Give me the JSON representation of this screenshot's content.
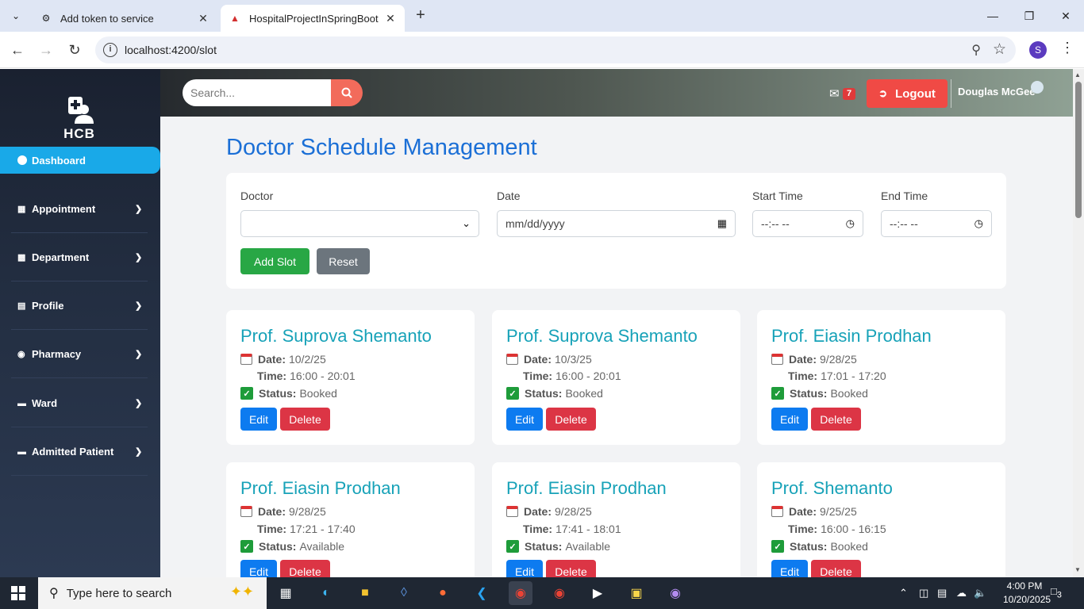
{
  "browser": {
    "tabs": [
      {
        "label": "Add token to service",
        "active": false
      },
      {
        "label": "HospitalProjectInSpringBoot",
        "active": true
      }
    ],
    "url": "localhost:4200/slot",
    "profile_initial": "S"
  },
  "sidebar": {
    "logo_text": "HCB",
    "active_item": "Dashboard",
    "items": [
      {
        "label": "Appointment",
        "icon": "calendar-icon"
      },
      {
        "label": "Department",
        "icon": "building-icon"
      },
      {
        "label": "Profile",
        "icon": "id-card-icon"
      },
      {
        "label": "Pharmacy",
        "icon": "pills-icon"
      },
      {
        "label": "Ward",
        "icon": "bed-icon"
      },
      {
        "label": "Admitted Patient",
        "icon": "bed-icon"
      }
    ]
  },
  "header": {
    "search_placeholder": "Search...",
    "mail_count": "7",
    "logout_label": "Logout",
    "user_name": "Douglas McGee"
  },
  "page": {
    "title": "Doctor Schedule Management",
    "form": {
      "doctor_label": "Doctor",
      "doctor_value": "",
      "date_label": "Date",
      "date_placeholder": "mm/dd/yyyy",
      "start_label": "Start Time",
      "start_placeholder": "--:-- --",
      "end_label": "End Time",
      "end_placeholder": "--:-- --",
      "add_label": "Add Slot",
      "reset_label": "Reset"
    },
    "labels": {
      "date": "Date:",
      "time": "Time:",
      "status": "Status:",
      "edit": "Edit",
      "delete": "Delete"
    },
    "slots": [
      {
        "doctor": "Prof. Suprova Shemanto",
        "date": "10/2/25",
        "time": "16:00 - 20:01",
        "status": "Booked"
      },
      {
        "doctor": "Prof. Suprova Shemanto",
        "date": "10/3/25",
        "time": "16:00 - 20:01",
        "status": "Booked"
      },
      {
        "doctor": "Prof. Eiasin Prodhan",
        "date": "9/28/25",
        "time": "17:01 - 17:20",
        "status": "Booked"
      },
      {
        "doctor": "Prof. Eiasin Prodhan",
        "date": "9/28/25",
        "time": "17:21 - 17:40",
        "status": "Available"
      },
      {
        "doctor": "Prof. Eiasin Prodhan",
        "date": "9/28/25",
        "time": "17:41 - 18:01",
        "status": "Available"
      },
      {
        "doctor": "Prof. Shemanto",
        "date": "9/25/25",
        "time": "16:00 - 16:15",
        "status": "Booked"
      }
    ]
  },
  "taskbar": {
    "search_placeholder": "Type here to search",
    "time": "4:00 PM",
    "date": "10/20/2025",
    "notification_count": "3"
  },
  "colors": {
    "sidebar_active": "#19a9e8",
    "title": "#1b6fd6",
    "doctor_name": "#17a2b8",
    "add_button": "#28a745",
    "reset_button": "#6c757d",
    "edit_button": "#0d7bf0",
    "delete_button": "#dc3545",
    "logout_button": "#f04a45"
  }
}
